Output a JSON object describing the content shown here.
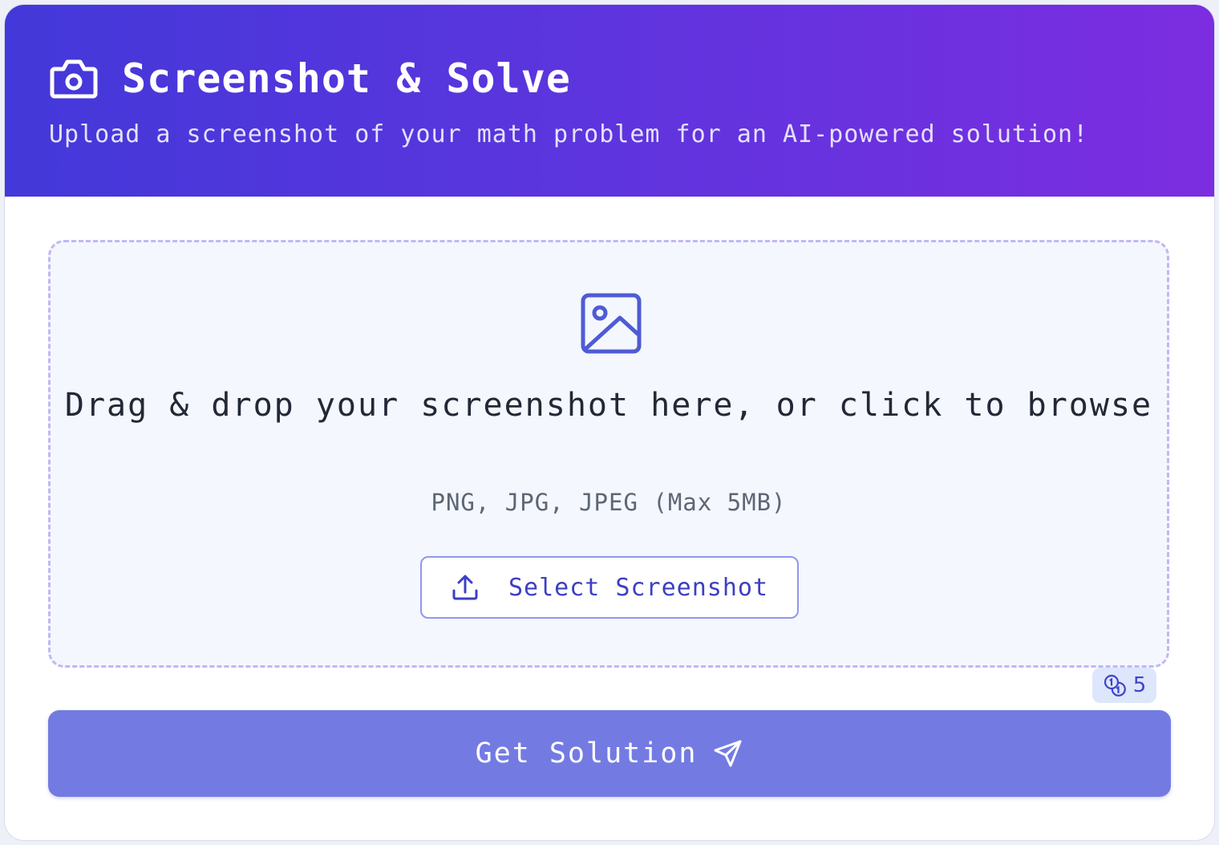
{
  "header": {
    "icon": "camera-icon",
    "title": "Screenshot & Solve",
    "subtitle": "Upload a screenshot of your math problem for an AI-powered solution!"
  },
  "dropzone": {
    "icon": "image-icon",
    "prompt": "Drag & drop your screenshot here, or click to browse",
    "formats": "PNG, JPG, JPEG (Max 5MB)",
    "select_button": {
      "icon": "upload-icon",
      "label": "Select Screenshot"
    }
  },
  "credits": {
    "icon": "coins-icon",
    "count": "5"
  },
  "submit_button": {
    "label": "Get Solution",
    "icon": "send-icon"
  },
  "colors": {
    "header_gradient_start": "#4338d9",
    "header_gradient_end": "#7c2de0",
    "accent": "#4f5bd5",
    "submit_button": "#737be3",
    "dropzone_border": "#c3b6f5"
  }
}
